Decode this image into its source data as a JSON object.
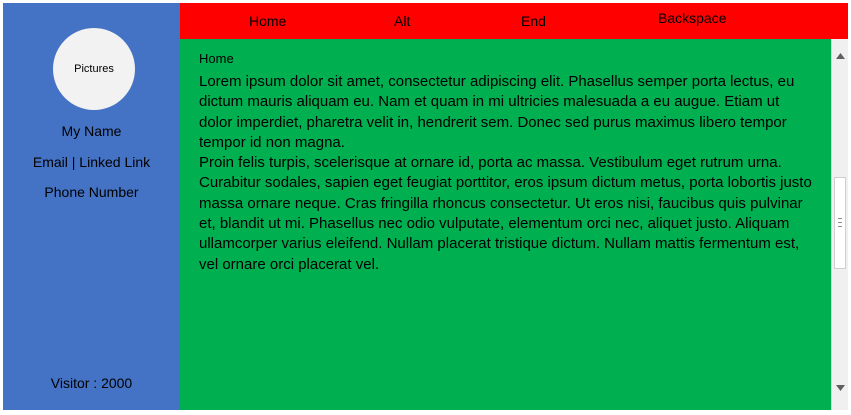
{
  "sidebar": {
    "avatar_label": "Pictures",
    "name": "My Name",
    "contact": "Email | Linked Link",
    "phone": "Phone Number",
    "visitor": "Visitor : 2000"
  },
  "nav": {
    "items": [
      "Home",
      "Alt",
      "End",
      "Backspace"
    ]
  },
  "main": {
    "breadcrumb": "Home",
    "paragraph1": "Lorem ipsum dolor sit amet, consectetur adipiscing elit. Phasellus semper porta lectus, eu dictum mauris aliquam eu. Nam et quam in mi ultricies malesuada a eu augue. Etiam ut dolor imperdiet, pharetra velit in, hendrerit sem. Donec sed purus maximus libero tempor tempor id non magna.",
    "paragraph2": "Proin felis turpis, scelerisque at ornare id, porta ac massa. Vestibulum eget rutrum urna. Curabitur sodales, sapien eget feugiat porttitor, eros ipsum dictum metus, porta lobortis justo massa ornare neque. Cras fringilla rhoncus consectetur. Ut eros nisi, faucibus quis pulvinar et, blandit ut mi. Phasellus nec odio vulputate, elementum orci nec, aliquet justo. Aliquam ullamcorper varius eleifend. Nullam placerat tristique dictum. Nullam mattis fermentum est, vel ornare orci placerat vel."
  },
  "scrollbar": {
    "up_icon": "arrow-up-icon",
    "down_icon": "arrow-down-icon"
  },
  "colors": {
    "sidebar": "#4472c4",
    "nav": "#ff0000",
    "content": "#00b050"
  }
}
